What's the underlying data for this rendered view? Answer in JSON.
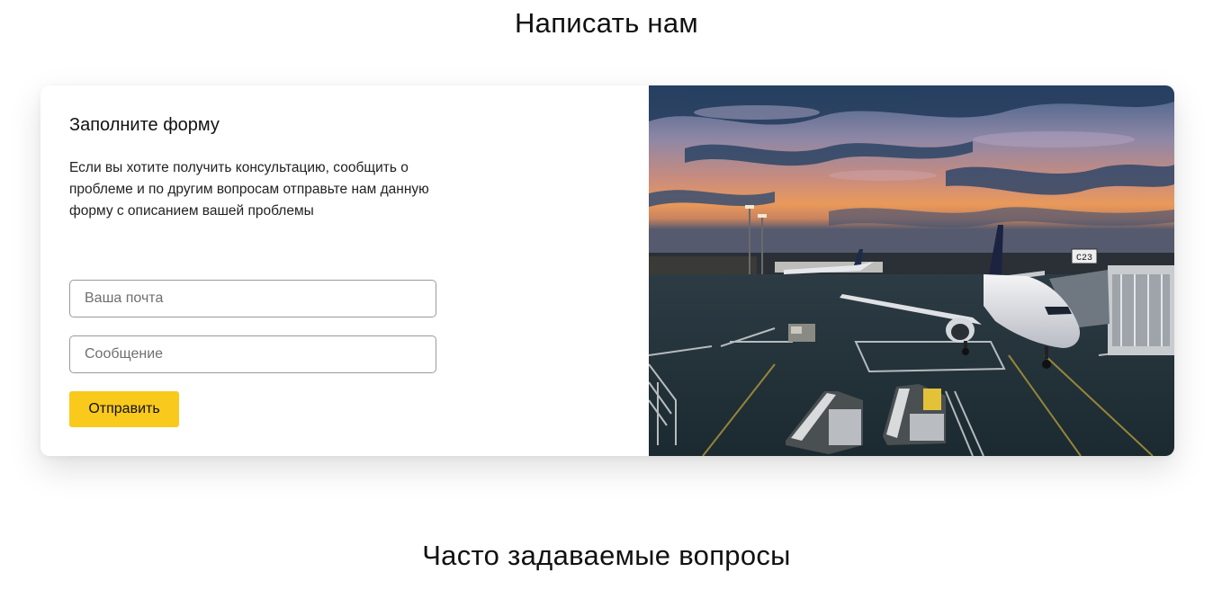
{
  "contact": {
    "title": "Написать нам",
    "form": {
      "heading": "Заполните форму",
      "description": "Если вы хотите получить консультацию, сообщить о проблеме и по другим вопросам отправьте нам данную форму с описанием вашей проблемы",
      "email_placeholder": "Ваша почта",
      "message_placeholder": "Сообщение",
      "submit_label": "Отправить"
    },
    "image": {
      "gate_sign": "C23"
    }
  },
  "faq": {
    "title": "Часто задаваемые вопросы"
  },
  "colors": {
    "accent": "#f9c91c",
    "text": "#111111",
    "field_border": "#9a9a9a"
  }
}
